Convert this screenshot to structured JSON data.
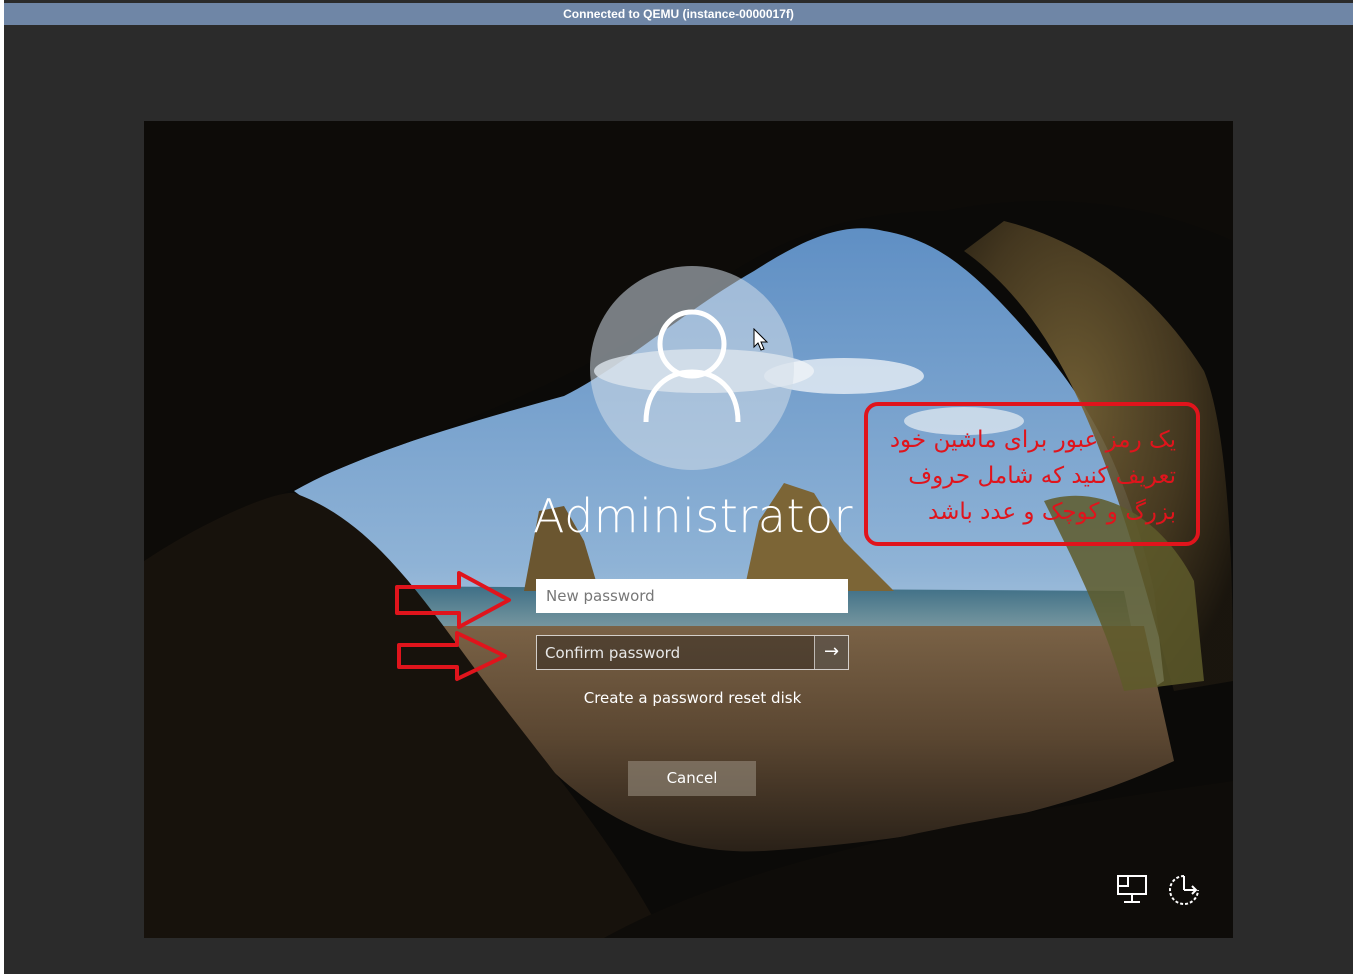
{
  "window": {
    "title": "Connected to QEMU (instance-0000017f)"
  },
  "login": {
    "username": "Administrator",
    "new_password_placeholder": "New password",
    "confirm_password_placeholder": "Confirm password",
    "submit_icon": "arrow-right-icon",
    "reset_link": "Create a password reset disk",
    "cancel_label": "Cancel"
  },
  "system_icons": {
    "network": "network-icon",
    "ease_of_access": "ease-of-access-icon"
  },
  "annotation": {
    "text_line1": "یک رمز عبور برای ماشین خود",
    "text_line2": "تعریف کنید که شامل حروف",
    "text_line3": "بزرگ و کوچک و عدد باشد",
    "color": "#e0141c"
  }
}
